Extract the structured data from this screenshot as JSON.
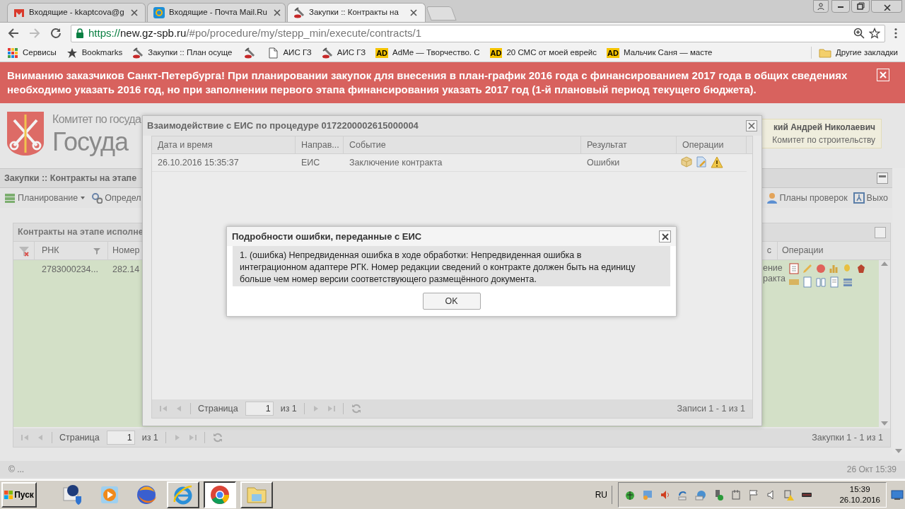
{
  "browser": {
    "tabs": [
      {
        "title": "Входящие - kkaptcova@g",
        "selected": false
      },
      {
        "title": "Входящие - Почта Mail.Ru",
        "selected": false
      },
      {
        "title": "Закупки :: Контракты на",
        "selected": true
      }
    ],
    "url": {
      "scheme": "https://",
      "host": "new.gz-spb.ru",
      "path": "/#po/procedure/my/stepp_min/execute/contracts/1"
    },
    "bookmarks": [
      {
        "label": "Сервисы"
      },
      {
        "label": "Bookmarks"
      },
      {
        "label": "Закупки :: План осуще"
      },
      {
        "kind": "icon_only"
      },
      {
        "label": "АИС ГЗ"
      },
      {
        "label": "АИС ГЗ"
      },
      {
        "badge": "AD",
        "label": "AdMe — Творчество. С"
      },
      {
        "badge": "AD",
        "label": "20 СМС от моей еврейс"
      },
      {
        "badge": "AD",
        "label": "Мальчик Саня — масте"
      }
    ],
    "other_bookmarks": "Другие закладки"
  },
  "banner": {
    "text": "Вниманию заказчиков Санкт-Петербурга! При планировании закупок для внесения в план-график 2016 года с финансированием 2017 года в общих сведениях необходимо указать 2016 год, но при заполнении первого этапа финансирования указать 2017 год (1-й плановый период текущего бюджета)."
  },
  "header": {
    "org_line": "Комитет по госуда",
    "title": "Госуда",
    "user": {
      "name": "кий Андрей Николаевич",
      "org": "Комитет по строительству"
    }
  },
  "panel": {
    "title": "Закупки :: Контракты на этапе",
    "toolbar_left": [
      {
        "label": "Планирование",
        "menu": true
      },
      {
        "label": "Определ",
        "menu": false
      }
    ],
    "toolbar_right": [
      {
        "label": "Планы проверок",
        "menu": false
      },
      {
        "label": "Выхо",
        "menu": false
      }
    ]
  },
  "grid": {
    "title": "Контракты на этапе исполне",
    "columns_left": [
      "РНК",
      "Номер"
    ],
    "columns_right": [
      "с",
      "Операции"
    ],
    "row": {
      "rnk": "2783000234...",
      "number": "282.14",
      "status": "ение\nракта"
    }
  },
  "pager": {
    "label": "Страница",
    "page": "1",
    "of": "из 1",
    "summary": "Закупки 1 - 1 из 1"
  },
  "footer": {
    "copyright": "© ...",
    "datetime": "26 Окт 15:39"
  },
  "dialog": {
    "title": "Взаимодействие с ЕИС по процедуре 0172200002615000004",
    "columns": [
      "Дата и время",
      "Направ...",
      "Событие",
      "Результат",
      "Операции"
    ],
    "rows": [
      {
        "cells": [
          "26.10.2016 15:35:37",
          "ЕИС",
          "Заключение контракта",
          "Ошибки"
        ]
      }
    ],
    "pager": {
      "label": "Страница",
      "page": "1",
      "of": "из 1",
      "summary": "Записи 1 - 1 из 1"
    }
  },
  "error_dialog": {
    "title": "Подробности ошибки, переданные с ЕИС",
    "message": "1. (ошибка) Непредвиденная ошибка в ходе обработки: Непредвиденная ошибка в интеграционном адаптере РГК. Номер редакции сведений о контракте должен быть на единицу больше чем номер версии соответствующего размещённого документа.",
    "button": "OK"
  },
  "taskbar": {
    "start": "Пуск",
    "apps": [
      {
        "open": false,
        "selected": false
      },
      {
        "open": false,
        "selected": false
      },
      {
        "open": false,
        "selected": false
      },
      {
        "open": true,
        "selected": false
      },
      {
        "open": true,
        "selected": true
      },
      {
        "open": true,
        "selected": false
      }
    ],
    "language": "RU",
    "time": "15:39",
    "date": "26.10.2016"
  }
}
